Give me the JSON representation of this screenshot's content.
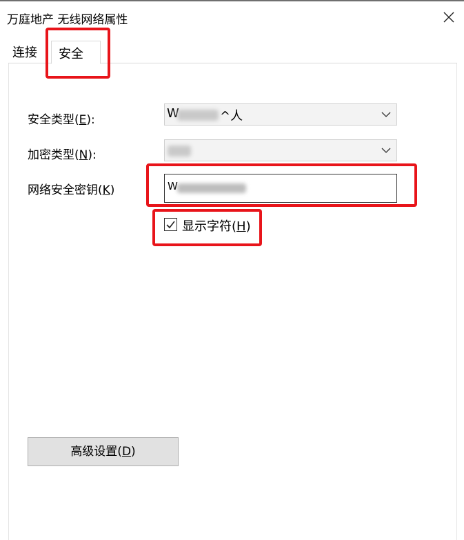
{
  "window": {
    "title": "万庭地产 无线网络属性",
    "close_icon": "close-icon"
  },
  "tabs": [
    {
      "label": "连接",
      "selected": false
    },
    {
      "label": "安全",
      "selected": true
    }
  ],
  "form": {
    "security_type": {
      "label": "安全类型(E):",
      "value_visible_prefix": "W",
      "value_visible_suffix": "^人"
    },
    "encryption_type": {
      "label": "加密类型(N):",
      "value_visible_prefix": ""
    },
    "network_key": {
      "label": "网络安全密钥(K)",
      "value_visible_prefix": "W"
    },
    "show_characters": {
      "label": "显示字符(H)",
      "checked": true
    }
  },
  "buttons": {
    "advanced": "高级设置(D)"
  },
  "annotation_color": "#e8141a"
}
